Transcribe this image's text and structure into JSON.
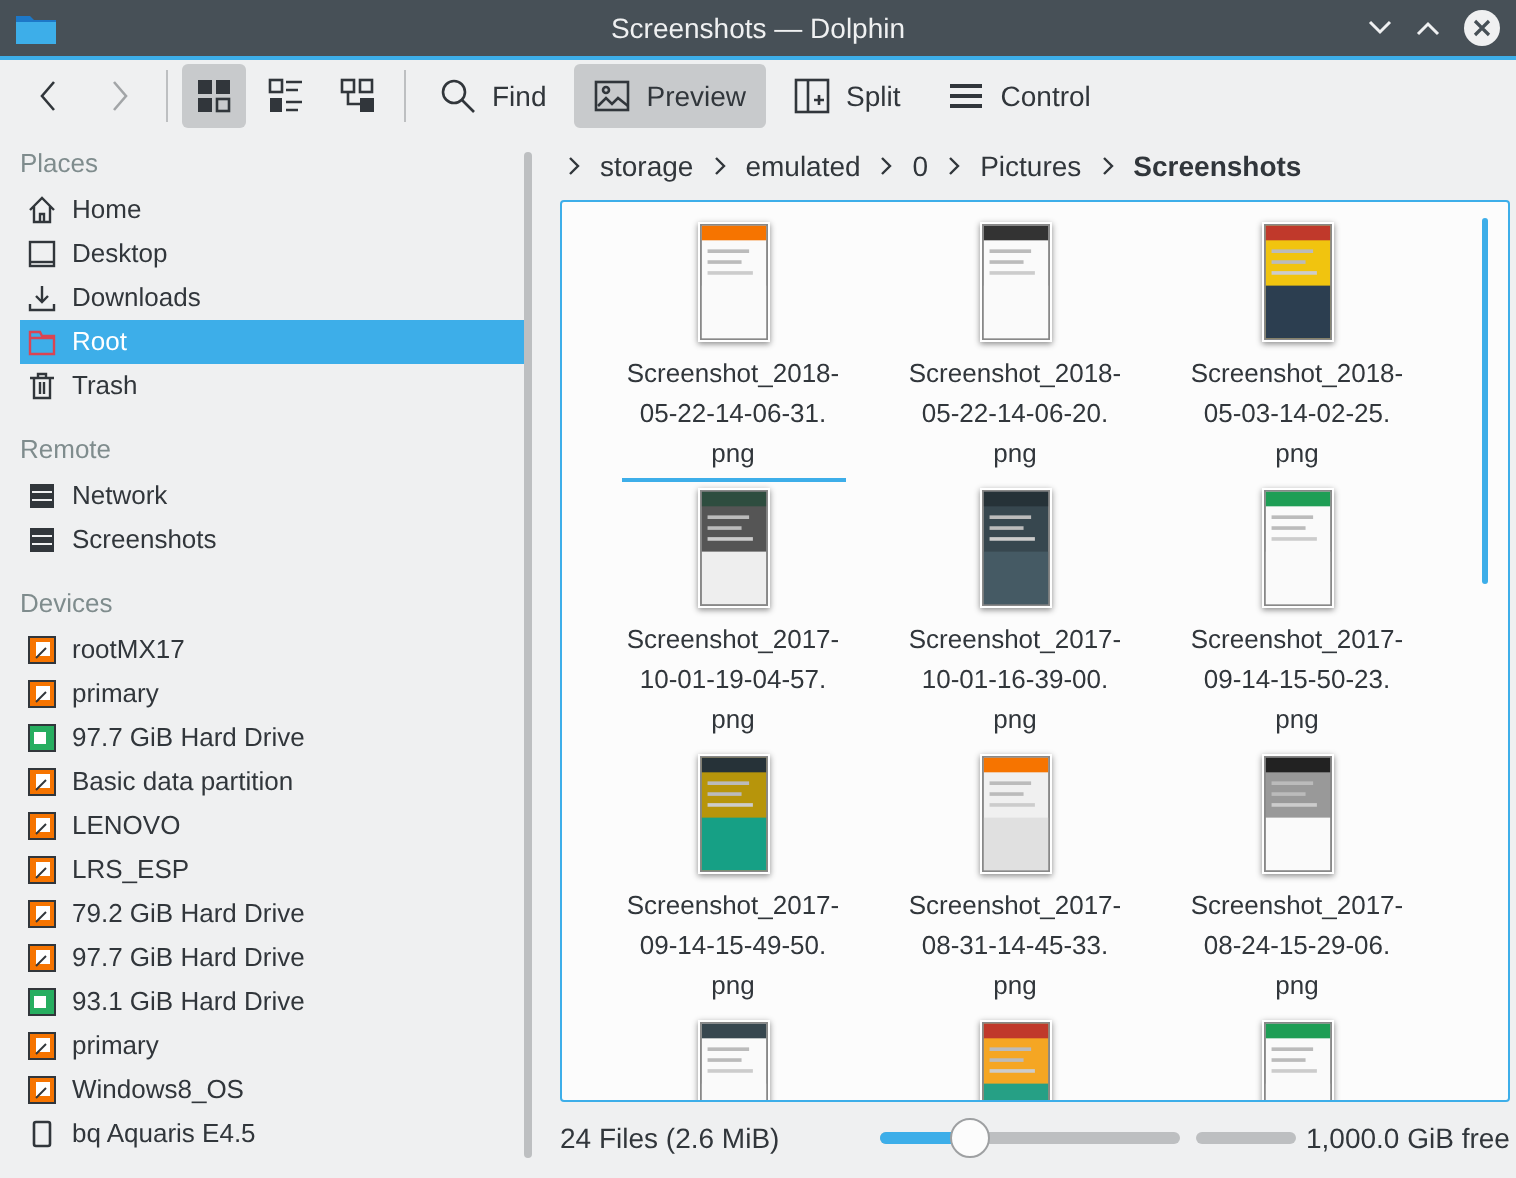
{
  "window": {
    "title": "Screenshots — Dolphin"
  },
  "toolbar": [
    {
      "kind": "back",
      "disabled": false
    },
    {
      "kind": "forward",
      "disabled": true
    },
    {
      "kind": "icons",
      "selected": true
    },
    {
      "kind": "details",
      "selected": false
    },
    {
      "kind": "tree",
      "selected": false
    },
    {
      "kind": "find",
      "label": "Find",
      "selected": false
    },
    {
      "kind": "preview",
      "label": "Preview",
      "selected": true
    },
    {
      "kind": "split",
      "label": "Split",
      "selected": false
    },
    {
      "kind": "control",
      "label": "Control",
      "selected": false
    }
  ],
  "sidebar": {
    "sections": [
      {
        "title": "Places",
        "items": [
          {
            "label": "Home",
            "kind": "home",
            "selected": false
          },
          {
            "label": "Desktop",
            "kind": "desktop",
            "selected": false
          },
          {
            "label": "Downloads",
            "kind": "downloads",
            "selected": false
          },
          {
            "label": "Root",
            "kind": "root",
            "selected": true
          },
          {
            "label": "Trash",
            "kind": "trash",
            "selected": false
          }
        ]
      },
      {
        "title": "Remote",
        "items": [
          {
            "label": "Network",
            "kind": "server",
            "selected": false
          },
          {
            "label": "Screenshots",
            "kind": "server",
            "selected": false
          }
        ]
      },
      {
        "title": "Devices",
        "items": [
          {
            "label": "rootMX17",
            "kind": "partition",
            "selected": false
          },
          {
            "label": "primary",
            "kind": "partition",
            "selected": false
          },
          {
            "label": "97.7 GiB Hard Drive",
            "kind": "disk",
            "selected": false
          },
          {
            "label": "Basic data partition",
            "kind": "partition",
            "selected": false
          },
          {
            "label": "LENOVO",
            "kind": "partition",
            "selected": false
          },
          {
            "label": "LRS_ESP",
            "kind": "partition",
            "selected": false
          },
          {
            "label": "79.2 GiB Hard Drive",
            "kind": "partition",
            "selected": false
          },
          {
            "label": "97.7 GiB Hard Drive",
            "kind": "partition",
            "selected": false
          },
          {
            "label": "93.1 GiB Hard Drive",
            "kind": "disk",
            "selected": false
          },
          {
            "label": "primary",
            "kind": "partition",
            "selected": false
          },
          {
            "label": "Windows8_OS",
            "kind": "partition",
            "selected": false
          },
          {
            "label": "bq Aquaris E4.5",
            "kind": "phone",
            "selected": false
          }
        ]
      }
    ]
  },
  "breadcrumb": [
    "storage",
    "emulated",
    "0",
    "Pictures",
    "Screenshots"
  ],
  "files": [
    {
      "kind": "file",
      "name": "Screenshot_2018-05-22-14-06-31.png",
      "focused": true
    },
    {
      "kind": "file",
      "name": "Screenshot_2018-05-22-14-06-20.png",
      "focused": false
    },
    {
      "kind": "file",
      "name": "Screenshot_2018-05-03-14-02-25.png",
      "focused": false
    },
    {
      "kind": "file",
      "name": "Screenshot_2017-10-01-19-04-57.png",
      "focused": false
    },
    {
      "kind": "file",
      "name": "Screenshot_2017-10-01-16-39-00.png",
      "focused": false
    },
    {
      "kind": "file",
      "name": "Screenshot_2017-09-14-15-50-23.png",
      "focused": false
    },
    {
      "kind": "file",
      "name": "Screenshot_2017-09-14-15-49-50.png",
      "focused": false
    },
    {
      "kind": "file",
      "name": "Screenshot_2017-08-31-14-45-33.png",
      "focused": false
    },
    {
      "kind": "file",
      "name": "Screenshot_2017-08-24-15-29-06.png",
      "focused": false
    },
    {
      "kind": "thumbnail"
    },
    {
      "kind": "thumbnail"
    },
    {
      "kind": "thumbnail"
    }
  ],
  "status_bar": {
    "summary": "24 Files (2.6 MiB)",
    "zoom": {
      "level": 0.3
    },
    "free_space": {
      "label": "1,000.0 GiB free"
    }
  }
}
